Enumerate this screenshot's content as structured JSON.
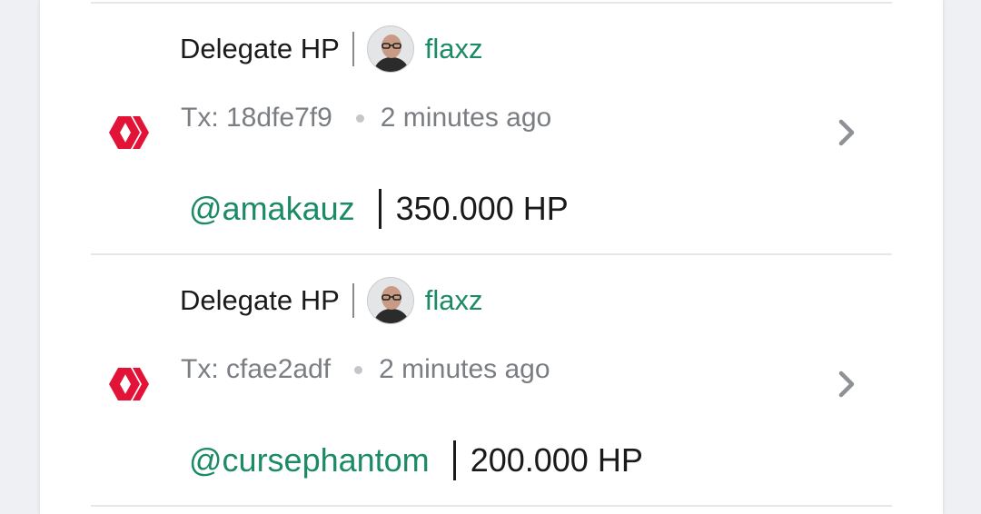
{
  "transactions": [
    {
      "operation": "Delegate HP",
      "user": "flaxz",
      "tx_label": "Tx: 18dfe7f9",
      "time": "2 minutes ago",
      "delegatee": "@amakauz",
      "amount": "350.000 HP"
    },
    {
      "operation": "Delegate HP",
      "user": "flaxz",
      "tx_label": "Tx: cfae2adf",
      "time": "2 minutes ago",
      "delegatee": "@cursephantom",
      "amount": "200.000 HP"
    }
  ],
  "colors": {
    "link": "#1b8a66",
    "hive_red": "#e31337",
    "muted_text": "#7a7d82",
    "divider": "#e6e7ea"
  },
  "icons": [
    "hive-logo-icon",
    "avatar",
    "chevron-right-icon"
  ]
}
